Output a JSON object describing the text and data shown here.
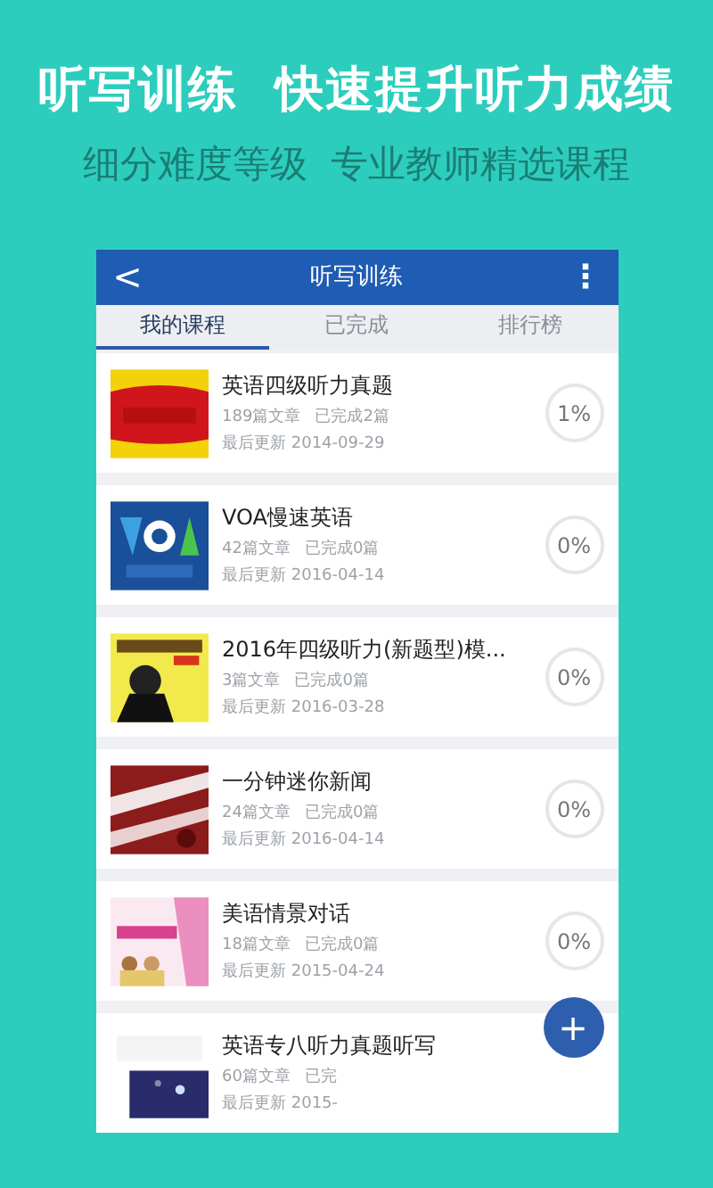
{
  "banner": {
    "headline": "听写训练  快速提升听力成绩",
    "subline": "细分难度等级  专业教师精选课程"
  },
  "app_bar": {
    "back": "<",
    "title": "听写训练",
    "menu": "⋮"
  },
  "tabs": [
    {
      "label": "我的课程",
      "selected": true
    },
    {
      "label": "已完成",
      "selected": false
    },
    {
      "label": "排行榜",
      "selected": false
    }
  ],
  "courses": [
    {
      "title": "英语四级听力真题",
      "articles": "189篇文章",
      "done": "已完成2篇",
      "updated": "最后更新 2014-09-29",
      "progress": "1%"
    },
    {
      "title": "VOA慢速英语",
      "articles": "42篇文章",
      "done": "已完成0篇",
      "updated": "最后更新 2016-04-14",
      "progress": "0%"
    },
    {
      "title": "2016年四级听力(新题型)模...",
      "articles": "3篇文章",
      "done": "已完成0篇",
      "updated": "最后更新 2016-03-28",
      "progress": "0%"
    },
    {
      "title": "一分钟迷你新闻",
      "articles": "24篇文章",
      "done": "已完成0篇",
      "updated": "最后更新 2016-04-14",
      "progress": "0%"
    },
    {
      "title": "美语情景对话",
      "articles": "18篇文章",
      "done": "已完成0篇",
      "updated": "最后更新 2015-04-24",
      "progress": "0%"
    },
    {
      "title": "英语专八听力真题听写",
      "articles": "60篇文章",
      "done": "已完",
      "updated": "最后更新 2015-"
    }
  ],
  "fab": {
    "label": "+"
  }
}
